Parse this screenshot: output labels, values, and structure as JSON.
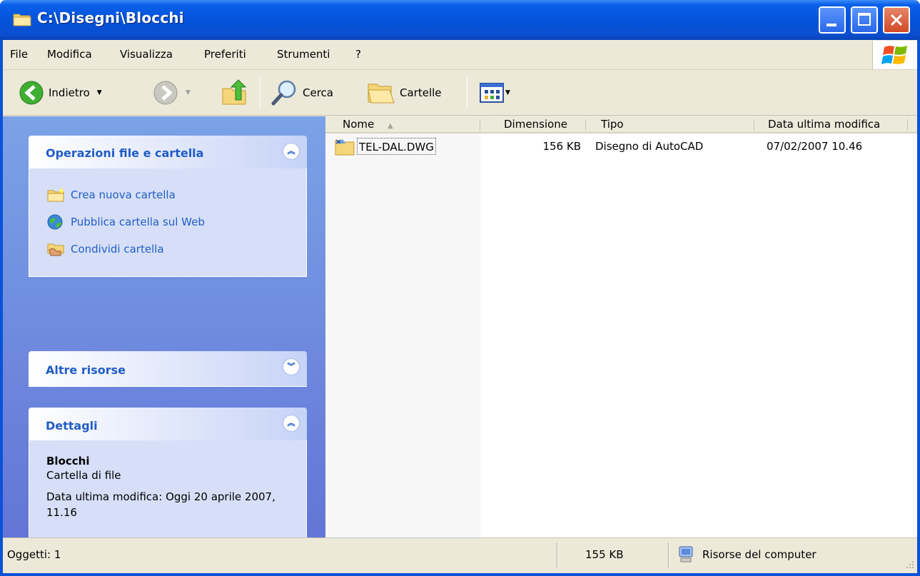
{
  "window": {
    "title": "C:\\Disegni\\Blocchi"
  },
  "menu": [
    "File",
    "Modifica",
    "Visualizza",
    "Preferiti",
    "Strumenti",
    "?"
  ],
  "toolbar": {
    "back_label": "Indietro",
    "search_label": "Cerca",
    "folders_label": "Cartelle"
  },
  "taskpane": {
    "file_ops": {
      "title": "Operazioni file e cartella",
      "items": [
        "Crea nuova cartella",
        "Pubblica cartella sul Web",
        "Condividi cartella"
      ]
    },
    "other": {
      "title": "Altre risorse"
    },
    "details": {
      "title": "Dettagli",
      "name": "Blocchi",
      "kind": "Cartella di file",
      "modified": "Data ultima modifica: Oggi 20 aprile 2007, 11.16"
    }
  },
  "filelist": {
    "columns": [
      "Nome",
      "Dimensione",
      "Tipo",
      "Data ultima modifica"
    ],
    "rows": [
      {
        "name": "TEL-DAL.DWG",
        "size": "156 KB",
        "type": "Disegno di AutoCAD",
        "modified": "07/02/2007 10.46"
      }
    ]
  },
  "status": {
    "objects": "Oggetti: 1",
    "size": "155 KB",
    "location": "Risorse del computer"
  },
  "icons": {
    "title": "folder-icon",
    "back": "back-arrow-icon",
    "forward": "forward-arrow-icon",
    "up": "folder-up-icon",
    "search": "search-icon",
    "folders": "folders-icon",
    "views": "views-icon"
  }
}
